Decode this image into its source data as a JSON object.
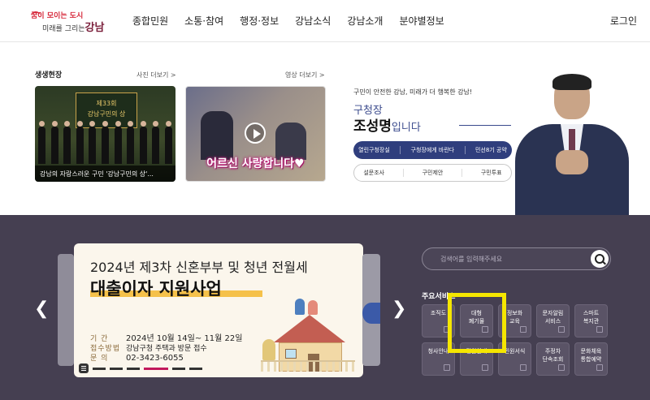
{
  "header": {
    "logo": {
      "line1": "꿈이 모이는 도시",
      "line2_small": "미래를 그리는",
      "line2_big": "강남"
    },
    "nav": [
      "종합민원",
      "소통·참여",
      "행정·정보",
      "강남소식",
      "강남소개",
      "분야별정보"
    ],
    "login": "로그인"
  },
  "news": {
    "title": "생생현장",
    "photo_more": "사진 더보기 >",
    "video_more": "영상 더보기 >",
    "photo_card": {
      "banner": "제33회\n강남구민의 상",
      "caption": "강남의 자랑스러운 구민 '강남구민의 상'..."
    },
    "video_card": {
      "overlay_text": "어르신 사랑합니다♥"
    }
  },
  "mayor": {
    "subtitle": "구민이 안전한 강남, 미래가 더 행복한 강남!",
    "title": "구청장",
    "name": "조성명",
    "name_suffix": "입니다",
    "primary_buttons": [
      "열린구청장실",
      "구청장에게 바란다",
      "민선8기 공약"
    ],
    "secondary_buttons": [
      "설문조사",
      "구민제안",
      "구민투표"
    ]
  },
  "slide": {
    "headline1": "2024년 제3차 신혼부부 및 청년 전월세",
    "headline2": "대출이자 지원사업",
    "rows": [
      {
        "key": "기  간",
        "value": "2024년 10월 14일~ 11월 22일"
      },
      {
        "key": "접수방법",
        "value": "강남구청 주택과 방문 접수"
      },
      {
        "key": "문  의",
        "value": "02-3423-6055"
      }
    ]
  },
  "search": {
    "placeholder": "검색어를 입력해주세요"
  },
  "services": {
    "title": "주요서비스",
    "tiles": [
      {
        "label": "조직도"
      },
      {
        "label": "대형\n폐기물"
      },
      {
        "label": "정보화\n교육"
      },
      {
        "label": "문자알림\n서비스"
      },
      {
        "label": "스마트\n복지관"
      },
      {
        "label": "청사안내"
      },
      {
        "label": "민원안내"
      },
      {
        "label": "민원서식"
      },
      {
        "label": "주정차\n단속조회"
      },
      {
        "label": "문화체육\n통합예약"
      }
    ]
  },
  "colors": {
    "navy": "#2f3e7d",
    "lower_bg": "#453f51",
    "highlight": "#f5e600",
    "accent_red": "#d6283a"
  }
}
